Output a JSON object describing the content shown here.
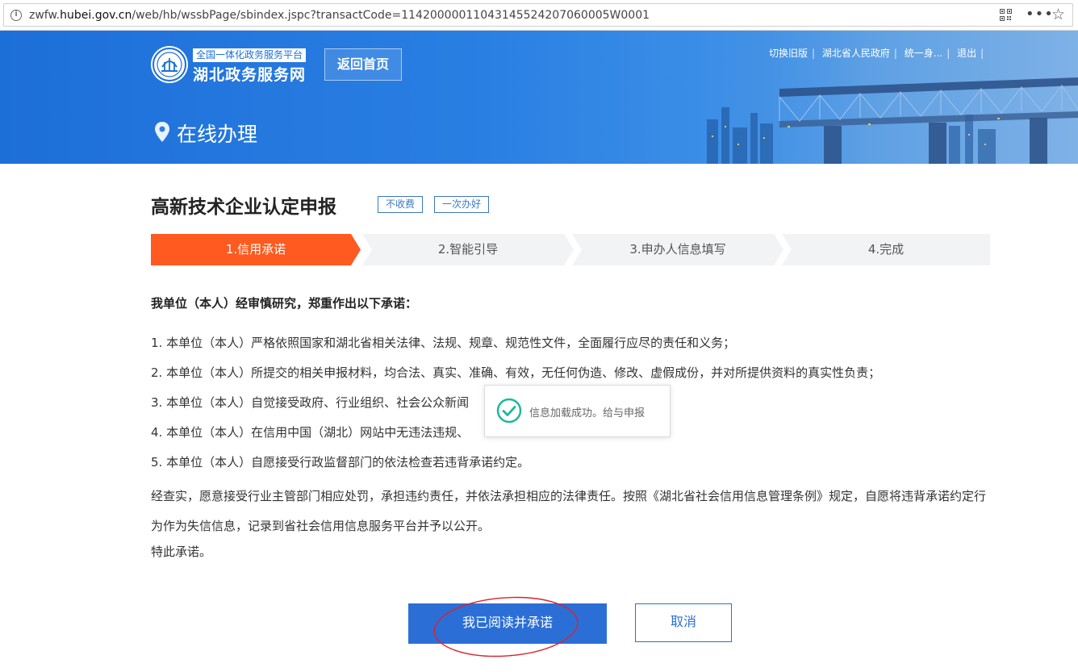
{
  "browser": {
    "url_prefix": "zwfw.",
    "url_host": "hubei.gov.cn",
    "url_path": "/web/hb/wssbPage/sbindex.jspc?transactCode=11420000011043145524207060005W0001",
    "icons": [
      "info-icon",
      "qr-code-icon",
      "more-icon",
      "star-icon"
    ]
  },
  "header": {
    "logo_tagline": "全国一体化政务服务平台",
    "logo_name": "湖北政务服务网",
    "home_button": "返回首页",
    "top_links": [
      "切换旧版",
      "湖北省人民政府",
      "统一身...",
      "退出"
    ],
    "section_title": "在线办理"
  },
  "main": {
    "title": "高新技术企业认定申报",
    "tags": [
      "不收费",
      "一次办好"
    ],
    "steps": [
      {
        "label": "1.信用承诺",
        "active": true
      },
      {
        "label": "2.智能引导",
        "active": false
      },
      {
        "label": "3.申办人信息填写",
        "active": false
      },
      {
        "label": "4.完成",
        "active": false
      }
    ],
    "intro": "我单位（本人）经审慎研究，郑重作出以下承诺：",
    "items": [
      "1. 本单位（本人）严格依照国家和湖北省相关法律、法规、规章、规范性文件，全面履行应尽的责任和义务；",
      "2. 本单位（本人）所提交的相关申报材料，均合法、真实、准确、有效，无任何伪造、修改、虚假成份，并对所提供资料的真实性负责；",
      "3. 本单位（本人）自觉接受政府、行业组织、社会公众新闻",
      "4. 本单位（本人）在信用中国（湖北）网站中无违法违规、",
      "5. 本单位（本人）自愿接受行政监督部门的依法检查若违背承诺约定。"
    ],
    "closing": "经查实，愿意接受行业主管部门相应处罚，承担违约责任，并依法承担相应的法律责任。按照《湖北省社会信用信息管理条例》规定，自愿将违背承诺约定行为作为失信信息，记录到省社会信用信息服务平台并予以公开。",
    "closing_end": "特此承诺。",
    "toast": "信息加载成功。给与申报",
    "confirm_button": "我已阅读并承诺",
    "cancel_button": "取消"
  },
  "colors": {
    "banner_blue": "#1d6fd8",
    "step_active": "#ff5a1f",
    "step_inactive": "#f2f3f5",
    "button_blue": "#2b6fd6",
    "tag_border": "#3b78c4",
    "toast_check": "#1fb89a",
    "annotation_red": "#d9232e"
  }
}
